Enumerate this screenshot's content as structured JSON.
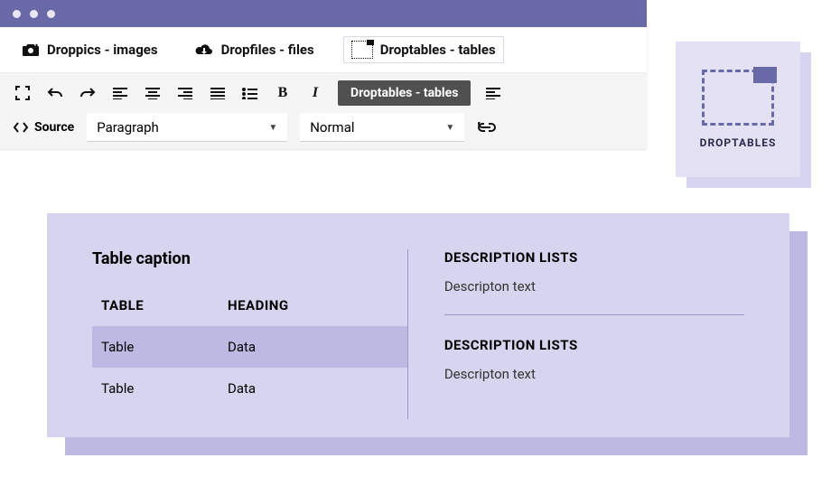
{
  "plugins": {
    "droppics": "Droppics - images",
    "dropfiles": "Dropfiles - files",
    "droptables": "Droptables - tables"
  },
  "toolbar": {
    "chip": "Droptables - tables",
    "source_label": "Source",
    "format_select": "Paragraph",
    "style_select": "Normal"
  },
  "side_card": {
    "label": "DROPTABLES"
  },
  "panel": {
    "caption": "Table caption",
    "table": {
      "headers": [
        "TABLE",
        "HEADING"
      ],
      "rows": [
        [
          "Table",
          "Data"
        ],
        [
          "Table",
          "Data"
        ]
      ]
    },
    "dlists": [
      {
        "title": "DESCRIPTION LISTS",
        "text": "Descripton text"
      },
      {
        "title": "DESCRIPTION LISTS",
        "text": "Descripton text"
      }
    ]
  }
}
